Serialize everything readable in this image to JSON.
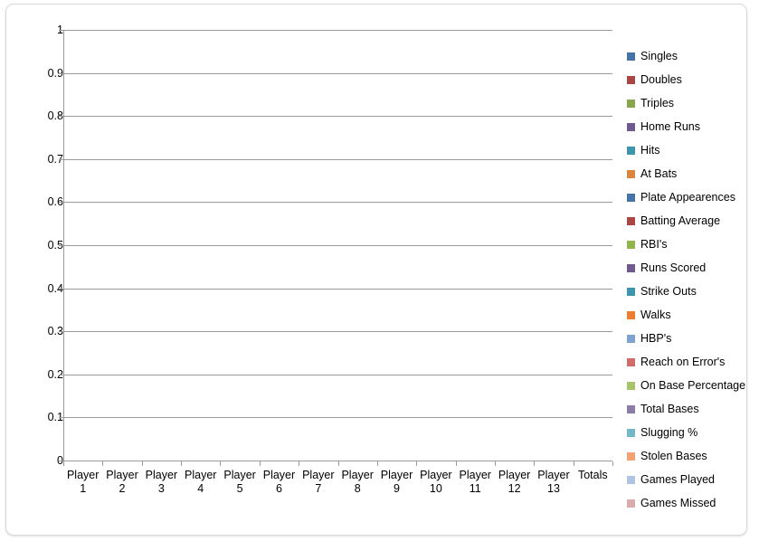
{
  "chart_data": {
    "type": "bar",
    "title": "",
    "subtitle": "",
    "xlabel": "",
    "ylabel": "",
    "ylim": [
      0,
      1
    ],
    "grid": true,
    "legend_position": "right",
    "categories": [
      "Player 1",
      "Player 2",
      "Player 3",
      "Player 4",
      "Player 5",
      "Player 6",
      "Player 7",
      "Player 8",
      "Player 9",
      "Player 10",
      "Player 11",
      "Player 12",
      "Player 13",
      "Totals"
    ],
    "category_lines": [
      [
        "Player",
        "1"
      ],
      [
        "Player",
        "2"
      ],
      [
        "Player",
        "3"
      ],
      [
        "Player",
        "4"
      ],
      [
        "Player",
        "5"
      ],
      [
        "Player",
        "6"
      ],
      [
        "Player",
        "7"
      ],
      [
        "Player",
        "8"
      ],
      [
        "Player",
        "9"
      ],
      [
        "Player",
        "10"
      ],
      [
        "Player",
        "11"
      ],
      [
        "Player",
        "12"
      ],
      [
        "Player",
        "13"
      ],
      [
        "Totals",
        ""
      ]
    ],
    "y_ticks": [
      "1",
      "0.9",
      "0.8",
      "0.7",
      "0.6",
      "0.5",
      "0.4",
      "0.3",
      "0.2",
      "0.1",
      "0"
    ],
    "y_tick_values": [
      1,
      0.9,
      0.8,
      0.7,
      0.6,
      0.5,
      0.4,
      0.3,
      0.2,
      0.1,
      0
    ],
    "series": [
      {
        "name": "Singles",
        "color": "#4572a7",
        "values": [
          0,
          0,
          0,
          0,
          0,
          0,
          0,
          0,
          0,
          0,
          0,
          0,
          0,
          0
        ]
      },
      {
        "name": "Doubles",
        "color": "#aa4643",
        "values": [
          0,
          0,
          0,
          0,
          0,
          0,
          0,
          0,
          0,
          0,
          0,
          0,
          0,
          0
        ]
      },
      {
        "name": "Triples",
        "color": "#89a54e",
        "values": [
          0,
          0,
          0,
          0,
          0,
          0,
          0,
          0,
          0,
          0,
          0,
          0,
          0,
          0
        ]
      },
      {
        "name": "Home Runs",
        "color": "#71588f",
        "values": [
          0,
          0,
          0,
          0,
          0,
          0,
          0,
          0,
          0,
          0,
          0,
          0,
          0,
          0
        ]
      },
      {
        "name": "Hits",
        "color": "#3d96ae",
        "values": [
          0,
          0,
          0,
          0,
          0,
          0,
          0,
          0,
          0,
          0,
          0,
          0,
          0,
          0
        ]
      },
      {
        "name": "At Bats",
        "color": "#db843d",
        "values": [
          0,
          0,
          0,
          0,
          0,
          0,
          0,
          0,
          0,
          0,
          0,
          0,
          0,
          0
        ]
      },
      {
        "name": "Plate Appearences",
        "color": "#4572a7",
        "values": [
          0,
          0,
          0,
          0,
          0,
          0,
          0,
          0,
          0,
          0,
          0,
          0,
          0,
          0
        ]
      },
      {
        "name": "Batting Average",
        "color": "#aa4643",
        "values": [
          0,
          0,
          0,
          0,
          0,
          0,
          0,
          0,
          0,
          0,
          0,
          0,
          0,
          0
        ]
      },
      {
        "name": "RBI's",
        "color": "#93b64c",
        "values": [
          0,
          0,
          0,
          0,
          0,
          0,
          0,
          0,
          0,
          0,
          0,
          0,
          0,
          0
        ]
      },
      {
        "name": "Runs Scored",
        "color": "#71588f",
        "values": [
          0,
          0,
          0,
          0,
          0,
          0,
          0,
          0,
          0,
          0,
          0,
          0,
          0,
          0
        ]
      },
      {
        "name": "Strike Outs",
        "color": "#3d96ae",
        "values": [
          0,
          0,
          0,
          0,
          0,
          0,
          0,
          0,
          0,
          0,
          0,
          0,
          0,
          0
        ]
      },
      {
        "name": "Walks",
        "color": "#ed7d31",
        "values": [
          0,
          0,
          0,
          0,
          0,
          0,
          0,
          0,
          0,
          0,
          0,
          0,
          0,
          0
        ]
      },
      {
        "name": "HBP's",
        "color": "#7fa3ce",
        "values": [
          0,
          0,
          0,
          0,
          0,
          0,
          0,
          0,
          0,
          0,
          0,
          0,
          0,
          0
        ]
      },
      {
        "name": "Reach on Error's",
        "color": "#d16b68",
        "values": [
          0,
          0,
          0,
          0,
          0,
          0,
          0,
          0,
          0,
          0,
          0,
          0,
          0,
          0
        ]
      },
      {
        "name": "On Base Percentage",
        "color": "#a8c46b",
        "values": [
          0,
          0,
          0,
          0,
          0,
          0,
          0,
          0,
          0,
          0,
          0,
          0,
          0,
          0
        ]
      },
      {
        "name": "Total Bases",
        "color": "#8e7ca8",
        "values": [
          0,
          0,
          0,
          0,
          0,
          0,
          0,
          0,
          0,
          0,
          0,
          0,
          0,
          0
        ]
      },
      {
        "name": "Slugging %",
        "color": "#72b8c7",
        "values": [
          0,
          0,
          0,
          0,
          0,
          0,
          0,
          0,
          0,
          0,
          0,
          0,
          0,
          0
        ]
      },
      {
        "name": "Stolen Bases",
        "color": "#f3a072",
        "values": [
          0,
          0,
          0,
          0,
          0,
          0,
          0,
          0,
          0,
          0,
          0,
          0,
          0,
          0
        ]
      },
      {
        "name": "Games Played",
        "color": "#aec4e0",
        "values": [
          0,
          0,
          0,
          0,
          0,
          0,
          0,
          0,
          0,
          0,
          0,
          0,
          0,
          0
        ]
      },
      {
        "name": "Games Missed",
        "color": "#dcacac",
        "values": [
          0,
          0,
          0,
          0,
          0,
          0,
          0,
          0,
          0,
          0,
          0,
          0,
          0,
          0
        ]
      }
    ]
  },
  "axis_colors": {
    "gridline": "#9a9a9a",
    "axis_line": "#9a9a9a",
    "text": "#000000"
  },
  "frame": {
    "border_color": "#d9d9d9",
    "background": "#ffffff"
  }
}
